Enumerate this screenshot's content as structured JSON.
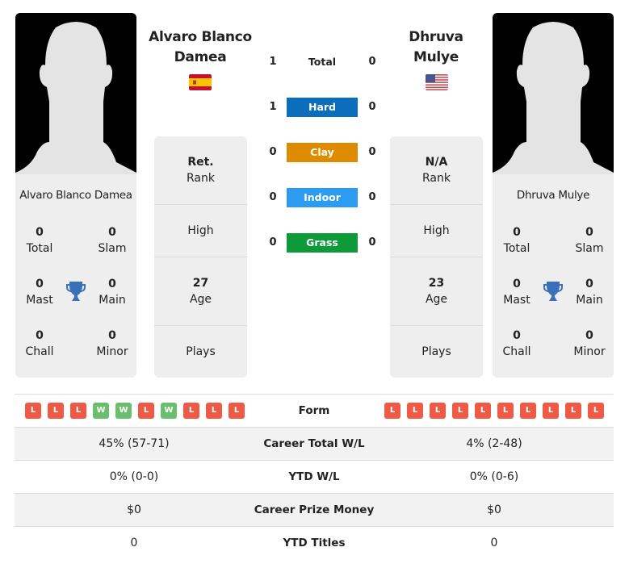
{
  "player1": {
    "name": "Alvaro Blanco Damea",
    "name_line1": "Alvaro Blanco",
    "name_line2": "Damea",
    "country_flag": "spain-flag",
    "titles": {
      "total": {
        "value": "0",
        "label": "Total"
      },
      "slam": {
        "value": "0",
        "label": "Slam"
      },
      "mast": {
        "value": "0",
        "label": "Mast"
      },
      "main": {
        "value": "0",
        "label": "Main"
      },
      "chall": {
        "value": "0",
        "label": "Chall"
      },
      "minor": {
        "value": "0",
        "label": "Minor"
      }
    },
    "info": {
      "rank_value": "Ret.",
      "rank_label": "Rank",
      "high_label": "High",
      "age_value": "27",
      "age_label": "Age",
      "plays_label": "Plays"
    },
    "form": [
      "L",
      "L",
      "L",
      "W",
      "W",
      "L",
      "W",
      "L",
      "L",
      "L"
    ]
  },
  "player2": {
    "name": "Dhruva Mulye",
    "name_line1": "Dhruva",
    "name_line2": "Mulye",
    "country_flag": "usa-flag",
    "titles": {
      "total": {
        "value": "0",
        "label": "Total"
      },
      "slam": {
        "value": "0",
        "label": "Slam"
      },
      "mast": {
        "value": "0",
        "label": "Mast"
      },
      "main": {
        "value": "0",
        "label": "Main"
      },
      "chall": {
        "value": "0",
        "label": "Chall"
      },
      "minor": {
        "value": "0",
        "label": "Minor"
      }
    },
    "info": {
      "rank_value": "N/A",
      "rank_label": "Rank",
      "high_label": "High",
      "age_value": "23",
      "age_label": "Age",
      "plays_label": "Plays"
    },
    "form": [
      "L",
      "L",
      "L",
      "L",
      "L",
      "L",
      "L",
      "L",
      "L",
      "L"
    ]
  },
  "h2h": [
    {
      "label": "Total",
      "p1": "1",
      "p2": "0",
      "color": ""
    },
    {
      "label": "Hard",
      "p1": "1",
      "p2": "0",
      "color": "#0a6ebd"
    },
    {
      "label": "Clay",
      "p1": "0",
      "p2": "0",
      "color": "#de8b00"
    },
    {
      "label": "Indoor",
      "p1": "0",
      "p2": "0",
      "color": "#2b9cf2"
    },
    {
      "label": "Grass",
      "p1": "0",
      "p2": "0",
      "color": "#0d9b3a"
    }
  ],
  "stats": [
    {
      "label": "Form",
      "p1": "",
      "p2": ""
    },
    {
      "label": "Career Total W/L",
      "p1": "45% (57-71)",
      "p2": "4% (2-48)"
    },
    {
      "label": "YTD W/L",
      "p1": "0% (0-0)",
      "p2": "0% (0-6)"
    },
    {
      "label": "Career Prize Money",
      "p1": "$0",
      "p2": "$0"
    },
    {
      "label": "YTD Titles",
      "p1": "0",
      "p2": "0"
    }
  ],
  "colors": {
    "win": "#6abf6e",
    "loss": "#ee5a45",
    "trophy": "#3a6fba",
    "card_bg": "#eeeeee"
  }
}
